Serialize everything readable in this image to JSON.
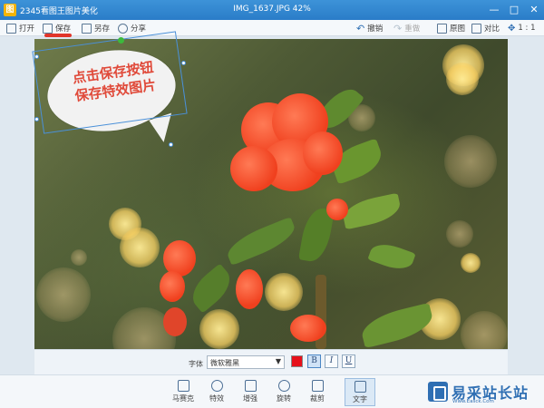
{
  "titlebar": {
    "app_title": "2345看图王图片美化",
    "file_title": "IMG_1637.JPG  42%",
    "min_label": "—",
    "max_label": "□",
    "close_label": "✕"
  },
  "toolbar": {
    "open": "打开",
    "save": "保存",
    "save_as": "另存",
    "share": "分享",
    "undo": "撤销",
    "redo": "重做",
    "original": "原图",
    "compare": "对比",
    "zoom": "1 : 1"
  },
  "canvas": {
    "bubble_text_line1": "点击保存按钮",
    "bubble_text_line2": "保存特效图片"
  },
  "format_bar": {
    "font_label": "字体",
    "font_value": "微软雅黑",
    "bold": "B",
    "italic": "I",
    "underline": "U",
    "text_color": "#e6101a"
  },
  "bottom_toolbar": {
    "items": [
      {
        "label": "马赛克",
        "icon": "mosaic-icon"
      },
      {
        "label": "特效",
        "icon": "effects-icon"
      },
      {
        "label": "增强",
        "icon": "enhance-icon"
      },
      {
        "label": "旋转",
        "icon": "rotate-icon"
      },
      {
        "label": "裁剪",
        "icon": "crop-icon"
      },
      {
        "label": "文字",
        "icon": "text-icon"
      }
    ]
  },
  "watermark": {
    "name": "易采站长站",
    "url": "Www.Easck.Com"
  }
}
